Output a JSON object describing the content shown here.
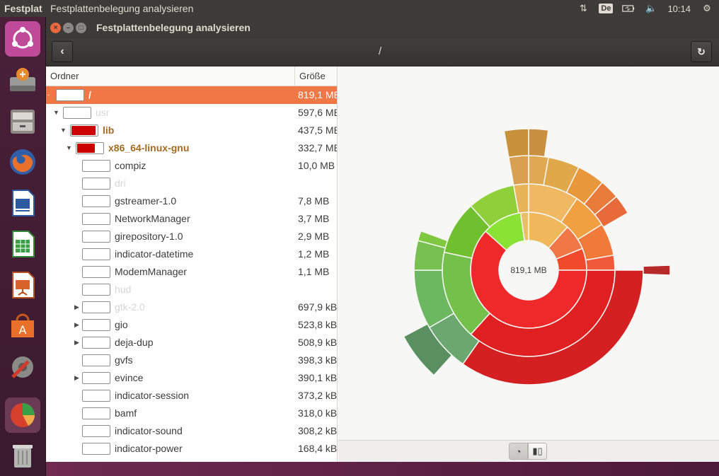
{
  "top_panel": {
    "app_name": "Festplat",
    "window_title": "Festplattenbelegung analysieren",
    "keyboard_layout": "De",
    "clock": "10:14",
    "icons": [
      "network-updown-icon",
      "keyboard-layout-icon",
      "battery-icon",
      "volume-icon",
      "session-gear-icon"
    ]
  },
  "launcher": {
    "items": [
      {
        "name": "ubuntu-dash-icon"
      },
      {
        "name": "software-updater-icon"
      },
      {
        "name": "file-manager-icon"
      },
      {
        "name": "firefox-icon"
      },
      {
        "name": "libreoffice-writer-icon"
      },
      {
        "name": "libreoffice-calc-icon"
      },
      {
        "name": "libreoffice-impress-icon"
      },
      {
        "name": "software-center-icon"
      },
      {
        "name": "system-settings-icon"
      },
      {
        "name": "disk-usage-analyzer-icon"
      },
      {
        "name": "trash-icon"
      }
    ]
  },
  "window": {
    "title": "Festplattenbelegung analysieren",
    "path": "/"
  },
  "tree": {
    "col_name": "Ordner",
    "col_size": "Größe",
    "rows": [
      {
        "name": "/",
        "size": "819,1 MB",
        "level": 0,
        "arrow": "-",
        "fill": 0,
        "selected": true
      },
      {
        "name": "usr",
        "size": "597,6 MB",
        "level": 1,
        "arrow": "▼",
        "fill": 0,
        "dim": true
      },
      {
        "name": "lib",
        "size": "437,5 MB",
        "level": 2,
        "arrow": "▼",
        "fill": 0.95,
        "bold": true
      },
      {
        "name": "x86_64-linux-gnu",
        "size": "332,7 MB",
        "level": 3,
        "arrow": "▼",
        "fill": 0.7,
        "bold": true
      },
      {
        "name": "compiz",
        "size": "10,0 MB",
        "level": 4
      },
      {
        "name": "dri",
        "size": "",
        "level": 4,
        "dim": true
      },
      {
        "name": "gstreamer-1.0",
        "size": "7,8 MB",
        "level": 4
      },
      {
        "name": "NetworkManager",
        "size": "3,7 MB",
        "level": 4
      },
      {
        "name": "girepository-1.0",
        "size": "2,9 MB",
        "level": 4
      },
      {
        "name": "indicator-datetime",
        "size": "1,2 MB",
        "level": 4
      },
      {
        "name": "ModemManager",
        "size": "1,1 MB",
        "level": 4
      },
      {
        "name": "hud",
        "size": "",
        "level": 4,
        "dim": true
      },
      {
        "name": "gtk-2.0",
        "size": "697,9 kB",
        "level": 4,
        "arrow": "▶",
        "dim": true
      },
      {
        "name": "gio",
        "size": "523,8 kB",
        "level": 4,
        "arrow": "▶"
      },
      {
        "name": "deja-dup",
        "size": "508,9 kB",
        "level": 4,
        "arrow": "▶"
      },
      {
        "name": "gvfs",
        "size": "398,3 kB",
        "level": 4
      },
      {
        "name": "evince",
        "size": "390,1 kB",
        "level": 4,
        "arrow": "▶"
      },
      {
        "name": "indicator-session",
        "size": "373,2 kB",
        "level": 4
      },
      {
        "name": "bamf",
        "size": "318,0 kB",
        "level": 4
      },
      {
        "name": "indicator-sound",
        "size": "308,2 kB",
        "level": 4
      },
      {
        "name": "indicator-power",
        "size": "168,4 kB",
        "level": 4
      }
    ]
  },
  "chart": {
    "center_label": "819,1 MB"
  },
  "colors": {
    "selection": "#f07746",
    "bar_fill": "#cc0000"
  }
}
